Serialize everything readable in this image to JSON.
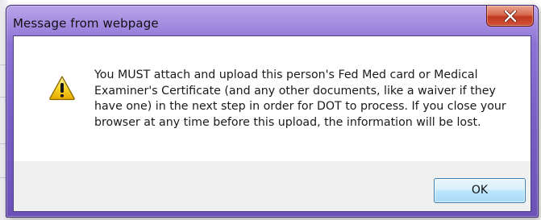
{
  "dialog": {
    "title": "Message from webpage",
    "close_icon": "close-x-icon",
    "message": "You MUST attach and upload this person's Fed Med card or Medical Examiner's Certificate (and any other documents, like a waiver if they have one) in the next step in order for DOT to process. If you close your browser at any time before this upload, the information will be lost.",
    "warning_icon": "warning-triangle-icon",
    "ok_label": "OK"
  },
  "colors": {
    "titlebar_accent": "#7a5ec8",
    "close_button": "#c1391f",
    "ok_button": "#bee6fd",
    "warning_yellow": "#f5c400"
  }
}
